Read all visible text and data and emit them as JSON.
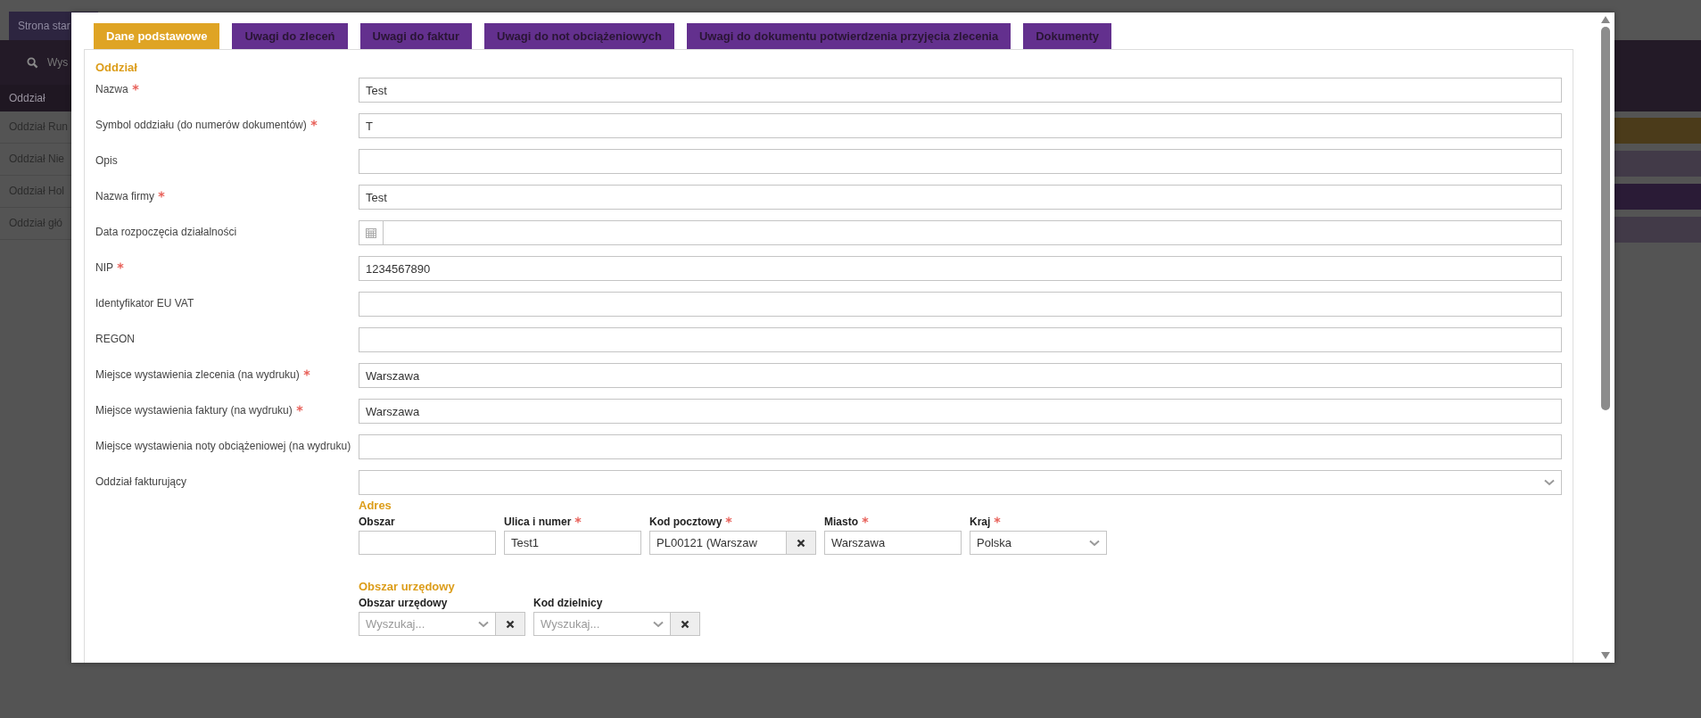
{
  "background": {
    "home_tab": "Strona star",
    "search_placeholder": "Wys",
    "list_header": "Oddział",
    "list_items": [
      "Oddział Run",
      "Oddział Nie",
      "Oddział Hol",
      "Oddział głó"
    ]
  },
  "dialog": {
    "tabs": [
      {
        "label": "Dane podstawowe",
        "selected": true
      },
      {
        "label": "Uwagi do zleceń",
        "selected": false
      },
      {
        "label": "Uwagi do faktur",
        "selected": false
      },
      {
        "label": "Uwagi do not obciążeniowych",
        "selected": false
      },
      {
        "label": "Uwagi do dokumentu potwierdzenia przyjęcia zlecenia",
        "selected": false
      },
      {
        "label": "Dokumenty",
        "selected": false
      }
    ],
    "section_title": "Oddział",
    "fields": [
      {
        "label": "Nazwa",
        "required": true,
        "kind": "text",
        "value": "Test"
      },
      {
        "label": "Symbol oddziału (do numerów dokumentów)",
        "required": true,
        "kind": "text",
        "value": "T"
      },
      {
        "label": "Opis",
        "required": false,
        "kind": "text"
      },
      {
        "label": "Nazwa firmy",
        "required": true,
        "kind": "text",
        "value": "Test"
      },
      {
        "label": "Data rozpoczęcia działalności",
        "required": false,
        "kind": "date"
      },
      {
        "label": "NIP",
        "required": true,
        "kind": "text",
        "value": "1234567890"
      },
      {
        "label": "Identyfikator EU VAT",
        "required": false,
        "kind": "text"
      },
      {
        "label": "REGON",
        "required": false,
        "kind": "text"
      },
      {
        "label": "Miejsce wystawienia zlecenia (na wydruku)",
        "required": true,
        "kind": "text",
        "value": "Warszawa"
      },
      {
        "label": "Miejsce wystawienia faktury (na wydruku)",
        "required": true,
        "kind": "text",
        "value": "Warszawa"
      },
      {
        "label": "Miejsce wystawienia noty obciążeniowej (na wydruku)",
        "required": false,
        "kind": "text"
      },
      {
        "label": "Oddział fakturujący",
        "required": false,
        "kind": "select"
      }
    ],
    "address": {
      "title": "Adres",
      "fields": [
        {
          "label": "Obszar",
          "required": false,
          "kind": "text"
        },
        {
          "label": "Ulica i numer",
          "required": true,
          "kind": "text",
          "value": "Test1"
        },
        {
          "label": "Kod pocztowy",
          "required": true,
          "kind": "lookup",
          "value": "PL00121 (Warszaw"
        },
        {
          "label": "Miasto",
          "required": true,
          "kind": "text",
          "value": "Warszawa"
        },
        {
          "label": "Kraj",
          "required": true,
          "kind": "select",
          "value": "Polska"
        }
      ]
    },
    "official_area": {
      "title": "Obszar urzędowy",
      "fields": [
        {
          "label": "Obszar urzędowy",
          "required": false,
          "kind": "search-select",
          "placeholder": "Wyszukaj..."
        },
        {
          "label": "Kod dzielnicy",
          "required": false,
          "kind": "search-select",
          "placeholder": "Wyszukaj..."
        }
      ]
    }
  }
}
